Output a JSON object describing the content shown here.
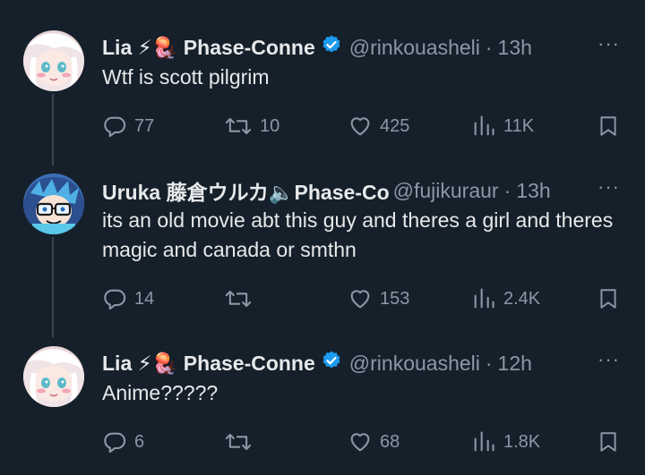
{
  "tweets": [
    {
      "name": "Lia ⚡🪼 Phase-Conne",
      "handle": "@rinkouasheli",
      "time": "13h",
      "verified": true,
      "text": "Wtf is scott pilgrim",
      "replies": "77",
      "retweets": "10",
      "likes": "425",
      "views": "11K"
    },
    {
      "name": "Uruka 藤倉ウルカ🔈Phase-Co",
      "handle": "@fujikuraur",
      "time": "13h",
      "verified": false,
      "text": "its an old movie abt this guy and theres a girl and theres magic and canada or smthn",
      "replies": "14",
      "retweets": "",
      "likes": "153",
      "views": "2.4K"
    },
    {
      "name": "Lia ⚡🪼 Phase-Conne",
      "handle": "@rinkouasheli",
      "time": "12h",
      "verified": true,
      "text": "Anime?????",
      "replies": "6",
      "retweets": "",
      "likes": "68",
      "views": "1.8K"
    }
  ],
  "separator": "·",
  "more_label": "···",
  "colors": {
    "background": "#15202b",
    "text": "#e7e9ea",
    "muted": "#8b98a5",
    "verified": "#1d9bf0",
    "thread_line": "#38444d"
  }
}
